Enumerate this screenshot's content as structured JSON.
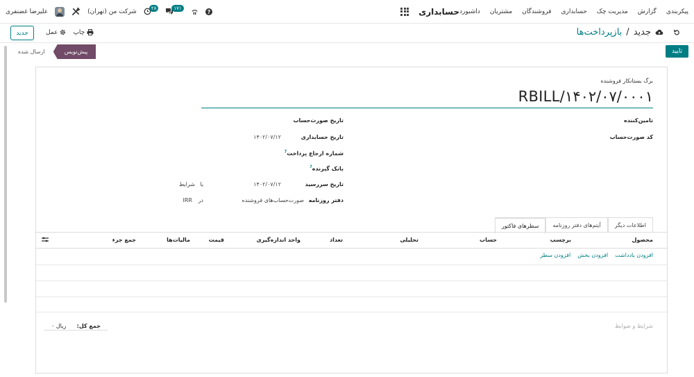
{
  "navbar": {
    "app_title": "حسابداری",
    "menu": [
      "داشبورد",
      "مشتریان",
      "فروشندگان",
      "حسابداری",
      "مدیریت چک",
      "گزارش",
      "پیکربندی"
    ],
    "company": "شرکت من (تهران)",
    "user_name": "علیرضا غضنفری",
    "activity_count": "۲۸",
    "messages_count": "۱۷۱",
    "icons": [
      "help-icon",
      "signal-icon",
      "clock-icon",
      "chat-icon",
      "tools-icon"
    ]
  },
  "control_panel": {
    "new_label": "جدید",
    "action_label": "عمل",
    "print_label": "چاپ",
    "breadcrumb_parent": "بازپرداخت‌ها",
    "breadcrumb_sep": "/",
    "breadcrumb_current": "جدید"
  },
  "status": {
    "confirm_label": "تایید",
    "states": [
      "پیش‌نویس",
      "ارسال شده"
    ],
    "active_state": "پیش‌نویس"
  },
  "form": {
    "doc_type_label": "برگ بستانکار فروشنده",
    "name": "RBILL/۱۴۰۲/۰۷/۰۰۰۱",
    "vendor_label": "تامین‌کننده",
    "bill_ref_label": "کد صورت‌حساب",
    "invoice_date_label": "تاریخ صورت‌حساب",
    "accounting_date_label": "تاریخ حسابداری",
    "accounting_date_value": "۱۴۰۲/۰۷/۱۲",
    "payment_ref_label": "شماره ارجاع پرداخت",
    "recipient_bank_label": "بانک گیرنده",
    "due_date_label": "تاریخ سررسید",
    "due_date_value": "۱۴۰۲/۰۷/۱۲",
    "or_label": "یا",
    "terms_value": "شرایط",
    "journal_label": "دفتر روزنامه",
    "journal_value": "صورت‌حساب‌های فروشنده",
    "in_label": "در",
    "currency_value": "IRR"
  },
  "tabs": [
    "سطرهای فاکتور",
    "آیتم‌های دفتر روزنامه",
    "اطلاعات دیگر"
  ],
  "table": {
    "columns": [
      "محصول",
      "برچسب",
      "حساب",
      "تحلیلی",
      "تعداد",
      "واحد اندازه‌گیری",
      "قیمت",
      "مالیات‌ها",
      "جمع جزء"
    ],
    "add_line": "افزودن سطر",
    "add_section": "افزودن بخش",
    "add_note": "افزودن یادداشت"
  },
  "footer": {
    "terms_placeholder": "شرایط و ضوابط",
    "total_label": "جمع کل:",
    "total_value": "ریال ۰"
  }
}
